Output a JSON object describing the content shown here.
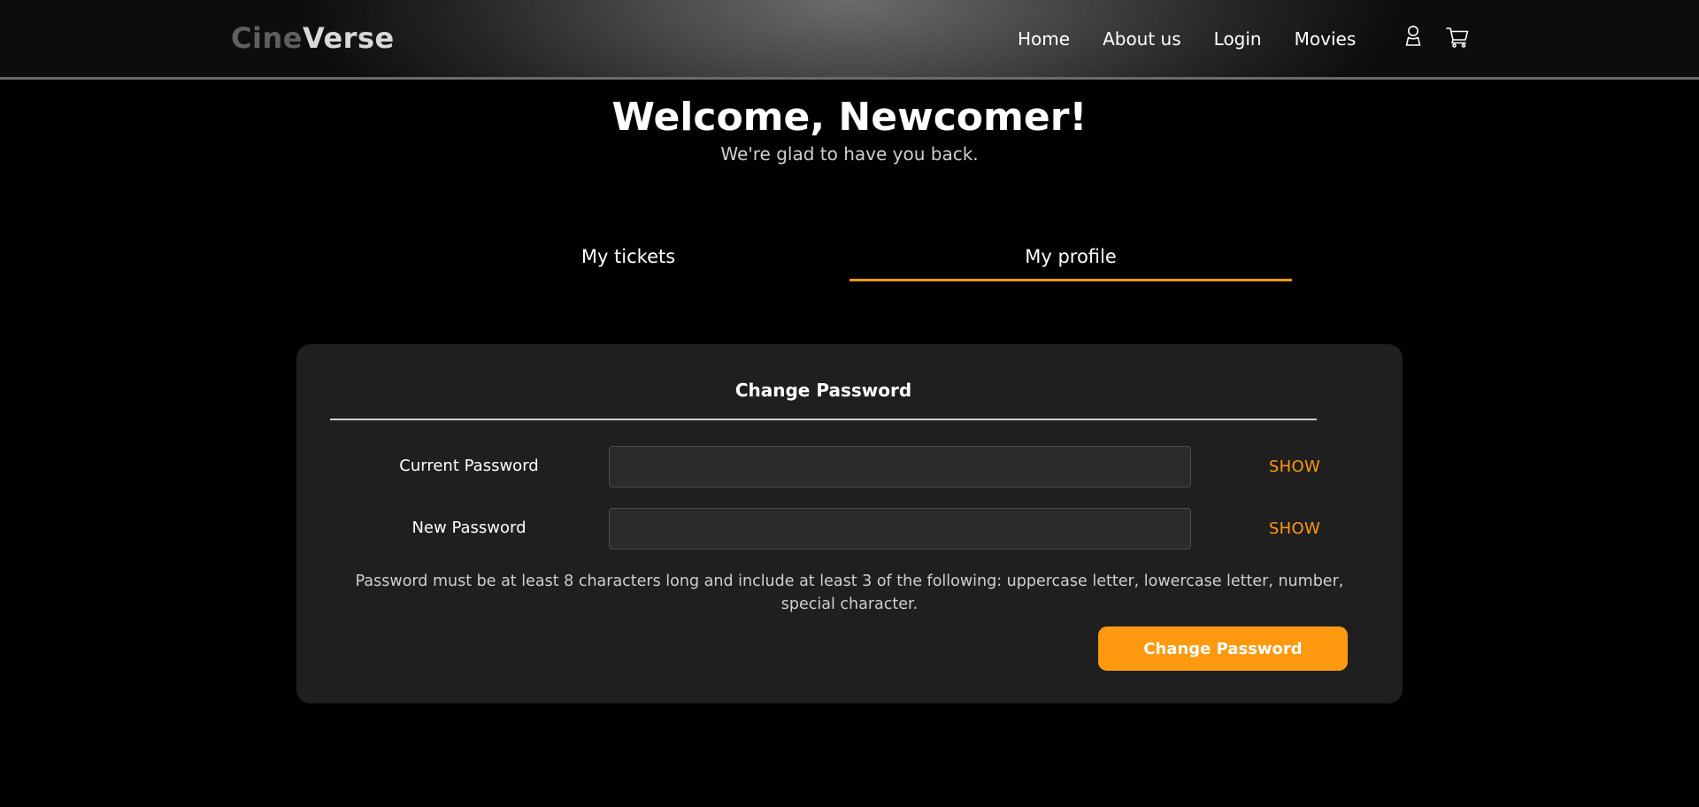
{
  "brand": {
    "name_part1": "Cine",
    "name_part2": "Verse"
  },
  "nav": {
    "links": [
      "Home",
      "About us",
      "Login",
      "Movies"
    ],
    "icons": [
      "user-icon",
      "cart-icon"
    ]
  },
  "hero": {
    "title": "Welcome, Newcomer!",
    "subtitle": "We're glad to have you back."
  },
  "tabs": [
    {
      "label": "My tickets",
      "active": false
    },
    {
      "label": "My profile",
      "active": true
    }
  ],
  "change_password": {
    "title": "Change Password",
    "fields": [
      {
        "label": "Current Password",
        "value": "",
        "toggle": "SHOW"
      },
      {
        "label": "New Password",
        "value": "",
        "toggle": "SHOW"
      }
    ],
    "hint": "Password must be at least 8 characters long and include at least 3 of the following: uppercase letter, lowercase letter, number, special character.",
    "submit_label": "Change Password"
  },
  "colors": {
    "accent": "#ff9910",
    "page_background": "#000000",
    "card_background": "#1f1f1f",
    "input_background": "#2b2b2b"
  }
}
